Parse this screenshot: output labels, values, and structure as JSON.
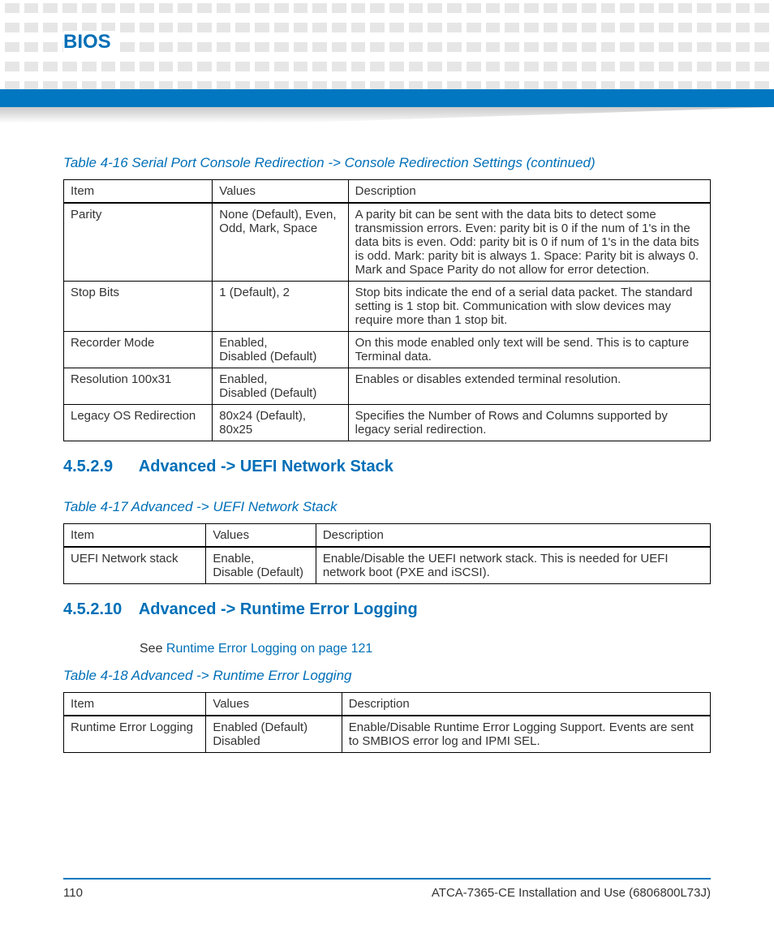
{
  "header": {
    "title": "BIOS"
  },
  "table16": {
    "caption": "Table 4-16 Serial Port Console Redirection -> Console Redirection Settings (continued)",
    "cols": [
      "Item",
      "Values",
      "Description"
    ],
    "rows": [
      {
        "item": "Parity",
        "values": "None (Default), Even, Odd, Mark, Space",
        "desc": "A parity bit can be sent with the data bits to detect some transmission errors. Even: parity bit is 0 if the num of 1's in the data bits is even. Odd: parity bit is 0 if num of 1's in the data bits is odd.  Mark: parity bit is always 1. Space: Parity bit is always 0. Mark and Space Parity do not allow for error detection."
      },
      {
        "item": "Stop Bits",
        "values": "1 (Default), 2",
        "desc": "Stop bits indicate the end of a serial data packet. The standard setting is 1 stop bit. Communication with slow devices may require more than 1 stop bit."
      },
      {
        "item": "Recorder Mode",
        "values": "Enabled,\nDisabled (Default)",
        "desc": "On this mode enabled only text will be send. This is to capture Terminal data."
      },
      {
        "item": "Resolution 100x31",
        "values": "Enabled,\nDisabled (Default)",
        "desc": "Enables or disables extended terminal resolution."
      },
      {
        "item": "Legacy OS Redirection",
        "values": "80x24 (Default), 80x25",
        "desc": "Specifies the Number of Rows and Columns supported by legacy serial redirection."
      }
    ]
  },
  "section9": {
    "num": "4.5.2.9",
    "title": "Advanced -> UEFI Network Stack"
  },
  "table17": {
    "caption": "Table 4-17 Advanced -> UEFI Network Stack",
    "cols": [
      "Item",
      "Values",
      "Description"
    ],
    "rows": [
      {
        "item": "UEFI Network stack",
        "values": "Enable,\nDisable (Default)",
        "desc": "Enable/Disable the UEFI network stack. This is needed for UEFI network boot (PXE and iSCSI)."
      }
    ]
  },
  "section10": {
    "num": "4.5.2.10",
    "title": "Advanced -> Runtime Error Logging",
    "see_prefix": "See ",
    "see_link": "Runtime Error Logging on page 121"
  },
  "table18": {
    "caption": "Table 4-18 Advanced -> Runtime Error Logging",
    "cols": [
      "Item",
      "Values",
      "Description"
    ],
    "rows": [
      {
        "item": "Runtime Error Logging",
        "values": "Enabled (Default)\nDisabled",
        "desc": "Enable/Disable Runtime Error Logging Support. Events are sent to SMBIOS error log and IPMI SEL."
      }
    ]
  },
  "footer": {
    "page": "110",
    "doc": "ATCA-7365-CE Installation and Use (6806800L73J)"
  }
}
